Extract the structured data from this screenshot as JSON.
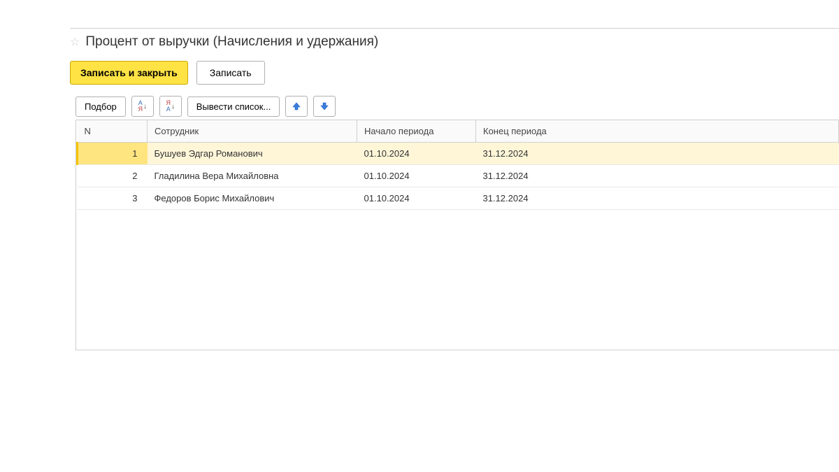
{
  "header": {
    "title": "Процент от выручки (Начисления и удержания)"
  },
  "toolbarMain": {
    "saveClose": "Записать и закрыть",
    "save": "Записать"
  },
  "toolbarTable": {
    "select": "Подбор",
    "exportList": "Вывести список..."
  },
  "table": {
    "columns": {
      "n": "N",
      "employee": "Сотрудник",
      "start": "Начало периода",
      "end": "Конец периода"
    },
    "rows": [
      {
        "n": "1",
        "employee": "Бушуев Эдгар Романович",
        "start": "01.10.2024",
        "end": "31.12.2024",
        "selected": true
      },
      {
        "n": "2",
        "employee": "Гладилина Вера Михайловна",
        "start": "01.10.2024",
        "end": "31.12.2024",
        "selected": false
      },
      {
        "n": "3",
        "employee": "Федоров Борис Михайлович",
        "start": "01.10.2024",
        "end": "31.12.2024",
        "selected": false
      }
    ]
  }
}
